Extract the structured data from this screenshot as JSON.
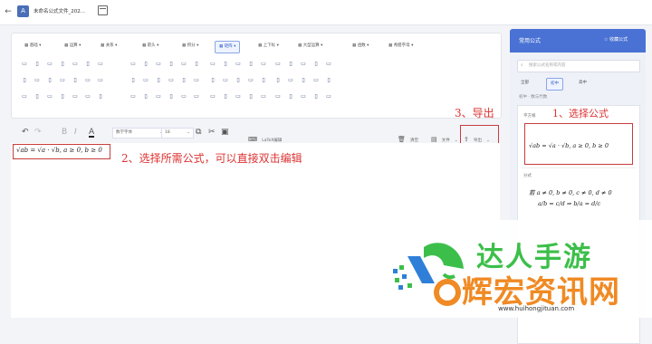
{
  "titlebar": {
    "back_icon": "arrow-left-icon",
    "app_icon": "app-logo-icon",
    "title": "未命名公式文件_202...",
    "tab_icon": "calendar-icon"
  },
  "formula_tabs": [
    {
      "label": "基础",
      "icon": "calculator-icon"
    },
    {
      "label": "运算",
      "icon": "operator-icon"
    },
    {
      "label": "关系",
      "icon": "relation-icon"
    },
    {
      "label": "箭头",
      "icon": "arrow-icon"
    },
    {
      "label": "积分",
      "icon": "integral-icon"
    },
    {
      "label": "矩阵",
      "icon": "matrix-icon"
    },
    {
      "label": "上下标",
      "icon": "script-icon"
    },
    {
      "label": "大型运算",
      "icon": "large-operator-icon"
    },
    {
      "label": "函数",
      "icon": "function-icon"
    },
    {
      "label": "希腊字母",
      "icon": "greek-icon"
    }
  ],
  "active_tab_index": 5,
  "editor_toolbar": {
    "font": "数学字体",
    "size": "18",
    "latex_label": "LaTeX编辑",
    "clear_label": "清空",
    "file_label": "文件",
    "export_label": "导出"
  },
  "formula_text": "√ab = √a · √b, a ≥ 0, b ≥ 0",
  "annotations": {
    "step1": "1、选择公式",
    "step2": "2、选择所需公式，可以直接双击编辑",
    "step3": "3、导出"
  },
  "right_panel": {
    "title": "常用公式",
    "collect_label": "收藏公式",
    "search_placeholder": "搜索公式名称或内容",
    "tabs": [
      "全部",
      "初中",
      "高中"
    ],
    "active_tab_index": 1,
    "category": "初中 · 数与代数",
    "section1_label": "平方根",
    "formula1": "√ab = √a · √b, a ≥ 0, b ≥ 0",
    "section2_label": "分式",
    "formula2_line1": "若 a ≠ 0, b ≠ 0, c ≠ 0, d ≠ 0",
    "formula2_line2": "a/b = c/d ⇒ b/a = d/c"
  },
  "watermark": {
    "brand_top": "达人手游",
    "brand_main": "辉宏资讯网",
    "url": "www.huihongjituan.com"
  },
  "colors": {
    "accent": "#4a72d4",
    "annotation_red": "#d33333",
    "watermark_green": "#3cbf4a",
    "watermark_blue": "#2f7fd8",
    "watermark_orange": "#f08a24"
  }
}
